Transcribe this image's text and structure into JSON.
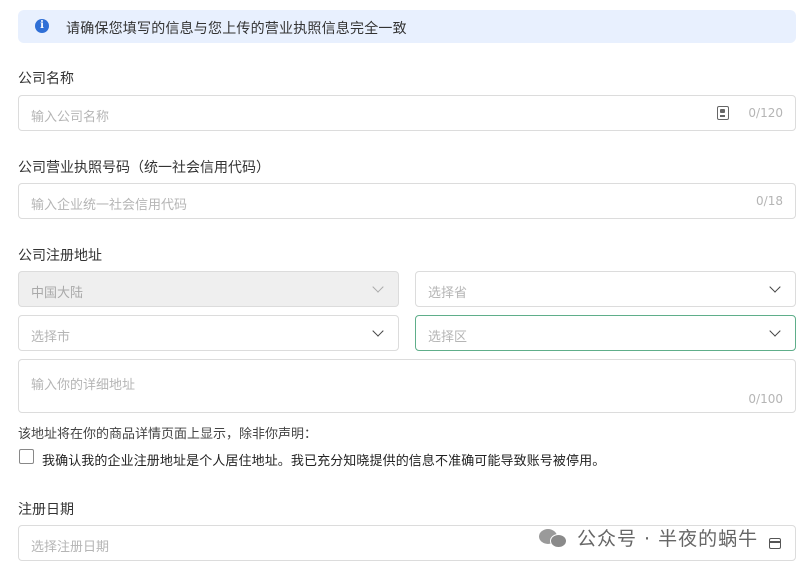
{
  "notice": {
    "text": "请确保您填写的信息与您上传的营业执照信息完全一致"
  },
  "company_name": {
    "label": "公司名称",
    "placeholder": "输入公司名称",
    "counter": "0/120"
  },
  "license_number": {
    "label": "公司营业执照号码（统一社会信用代码）",
    "placeholder": "输入企业统一社会信用代码",
    "counter": "0/18"
  },
  "address": {
    "label": "公司注册地址",
    "country": "中国大陆",
    "province_placeholder": "选择省",
    "city_placeholder": "选择市",
    "district_placeholder": "选择区",
    "detail_placeholder": "输入你的详细地址",
    "detail_counter": "0/100",
    "hint": "该地址将在你的商品详情页面上显示，除非你声明：",
    "checkbox_label": "我确认我的企业注册地址是个人居住地址。我已充分知晓提供的信息不准确可能导致账号被停用。",
    "checkbox_checked": false
  },
  "registration_date": {
    "label": "注册日期",
    "placeholder": "选择注册日期"
  },
  "watermark": {
    "text": "公众号 · 半夜的蜗牛"
  },
  "colors": {
    "notice_bg": "#e8f0fe",
    "info_icon": "#2f6fd6",
    "focus_border": "#5fae8a"
  }
}
